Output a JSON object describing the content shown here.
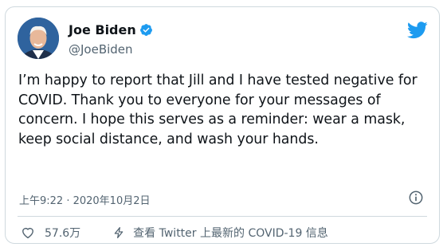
{
  "tweet": {
    "author": {
      "display_name": "Joe Biden",
      "handle": "@JoeBiden",
      "verified": true
    },
    "text": "I’m happy to report that Jill and I have tested negative for COVID. Thank you to everyone for your messages of concern. I hope this serves as a reminder: wear a mask, keep social distance, and wash your hands.",
    "timestamp": "上午9:22 · 2020年10月2日"
  },
  "actions": {
    "like_count": "57.6万",
    "share_label": "查看 Twitter 上最新的 COVID-19 信息"
  },
  "icons": {
    "verified": "verified-badge-icon",
    "brand": "twitter-bird-icon",
    "info": "info-icon",
    "like": "heart-icon",
    "share": "lightning-icon"
  },
  "colors": {
    "brand": "#1d9bf0",
    "verified": "#1d9bf0",
    "text": "#0f1419",
    "secondary": "#536471",
    "border": "#cfd9de"
  }
}
